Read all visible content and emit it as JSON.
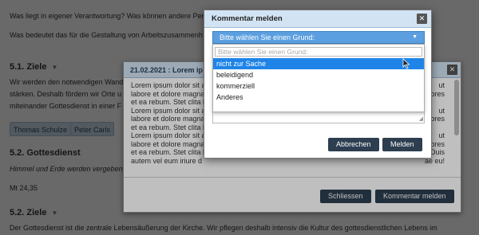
{
  "page": {
    "line1": "Was liegt in eigener Verantwortung? Was können andere Per",
    "line2": "Was bedeutet das für die Gestaltung von Arbeitszusammenh",
    "h1": "5.1. Ziele",
    "p1a": "Wir werden den notwendigen Wand",
    "p1b": "stärken. Deshalb fördern wir Orte u",
    "p1c": "miteinander Gottesdienst in einer F",
    "tags": [
      "Thomas Schulze",
      "Peter Carls"
    ],
    "h2": "5.2. Gottesdienst",
    "p2": "Himmel und Erde werden vergeben",
    "ref": "Mt 24,35",
    "h3": "5.2. Ziele",
    "p3": "Der Gottesdienst ist die zentrale Lebensäußerung der Kirche. Wir pflegen deshalb intensiv die Kultur des gottesdienstlichen Lebens im"
  },
  "comment_dialog": {
    "title": "21.02.2021 : Lorem ip",
    "close": "✕",
    "lines": [
      "Lorem ipsum dolor sit a",
      "labore et dolore magna",
      "et ea rebum. Stet clita l",
      "Lorem ipsum dolor sit a",
      "labore et dolore magna",
      "et ea rebum. Stet clita l",
      "Lorem ipsum dolor sit a",
      "labore et dolore magna",
      "et ea rebum. Stet clita l",
      "autem vel eum iriure d"
    ],
    "right_lines": [
      "ut",
      "dolores",
      "",
      "ut",
      "dolores",
      "",
      "ut",
      "dolores",
      "Duis",
      "ae eu!"
    ],
    "close_button": "Schliessen",
    "report_button": "Kommentar melden"
  },
  "report_dialog": {
    "title": "Kommentar melden",
    "close": "✕",
    "select_value": "Bitte wählen Sie einen Grund:",
    "search_placeholder": "Bitte wählen Sie einen Grund:",
    "options": [
      "nicht zur Sache",
      "beleidigend",
      "kommerziell",
      "Anderes"
    ],
    "selected_option": "nicht zur Sache",
    "cancel_button": "Abbrechen",
    "submit_button": "Melden"
  },
  "colors": {
    "title_bar": "#d2e3f3",
    "select_bg": "#5b9fe0",
    "option_highlight": "#1e84e8",
    "button_bg": "#2c3e50"
  }
}
